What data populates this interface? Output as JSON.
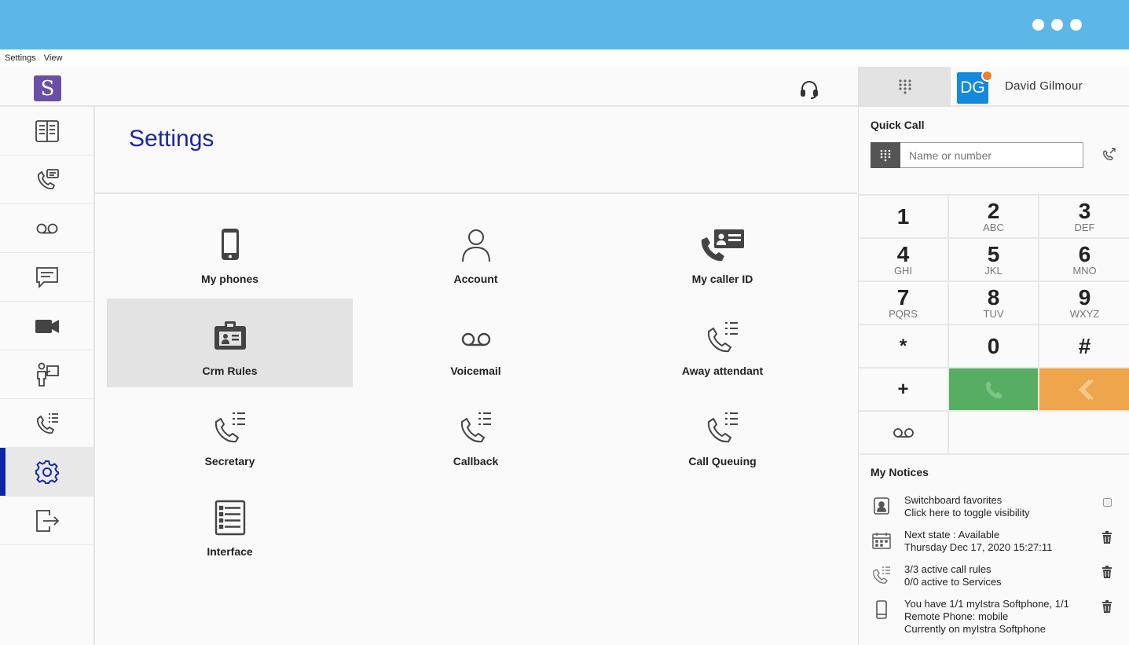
{
  "menu": {
    "items": [
      "Settings",
      "View"
    ]
  },
  "header": {
    "logo_letter": "S"
  },
  "page": {
    "title": "Settings"
  },
  "tiles": [
    {
      "label": "My phones",
      "icon": "mobile-phone-icon"
    },
    {
      "label": "Account",
      "icon": "user-icon"
    },
    {
      "label": "My caller ID",
      "icon": "caller-id-icon"
    },
    {
      "label": "Crm Rules",
      "icon": "crm-badge-icon",
      "selected": true
    },
    {
      "label": "Voicemail",
      "icon": "voicemail-icon"
    },
    {
      "label": "Away attendant",
      "icon": "phone-list-icon"
    },
    {
      "label": "Secretary",
      "icon": "phone-list-icon"
    },
    {
      "label": "Callback",
      "icon": "phone-list-icon"
    },
    {
      "label": "Call Queuing",
      "icon": "phone-list-icon"
    },
    {
      "label": "Interface",
      "icon": "document-list-icon"
    }
  ],
  "sidebar": {
    "items": [
      {
        "icon": "directory-book-icon"
      },
      {
        "icon": "phone-card-icon"
      },
      {
        "icon": "voicemail-icon"
      },
      {
        "icon": "chat-icon"
      },
      {
        "icon": "video-camera-icon"
      },
      {
        "icon": "presenter-icon"
      },
      {
        "icon": "phone-list-icon"
      },
      {
        "icon": "gear-icon",
        "active": true
      },
      {
        "icon": "logout-icon"
      }
    ]
  },
  "user": {
    "initials": "DG",
    "name": "David Gilmour"
  },
  "quick_call": {
    "title": "Quick Call",
    "placeholder": "Name or number"
  },
  "keypad": {
    "keys": [
      {
        "digit": "1",
        "letters": ""
      },
      {
        "digit": "2",
        "letters": "ABC"
      },
      {
        "digit": "3",
        "letters": "DEF"
      },
      {
        "digit": "4",
        "letters": "GHI"
      },
      {
        "digit": "5",
        "letters": "JKL"
      },
      {
        "digit": "6",
        "letters": "MNO"
      },
      {
        "digit": "7",
        "letters": "PQRS"
      },
      {
        "digit": "8",
        "letters": "TUV"
      },
      {
        "digit": "9",
        "letters": "WXYZ"
      },
      {
        "digit": "*",
        "letters": ""
      },
      {
        "digit": "0",
        "letters": ""
      },
      {
        "digit": "#",
        "letters": ""
      },
      {
        "digit": "+",
        "letters": ""
      }
    ]
  },
  "colors": {
    "call": "#57ad62",
    "back": "#efa54c",
    "accent": "#1a27a0",
    "titlebar": "#5db6e8"
  },
  "notices": {
    "title": "My Notices",
    "items": [
      {
        "line1": "Switchboard favorites",
        "line2": "Click here to toggle visibility",
        "line3": ""
      },
      {
        "line1": "Next state : Available",
        "line2": "Thursday Dec 17, 2020 15:27:11",
        "line3": ""
      },
      {
        "line1": "3/3 active call rules",
        "line2": "0/0 active to Services",
        "line3": ""
      },
      {
        "line1": "You have 1/1 myIstra Softphone, 1/1",
        "line2": "Remote Phone: mobile",
        "line3": "Currently on myIstra Softphone"
      }
    ]
  }
}
